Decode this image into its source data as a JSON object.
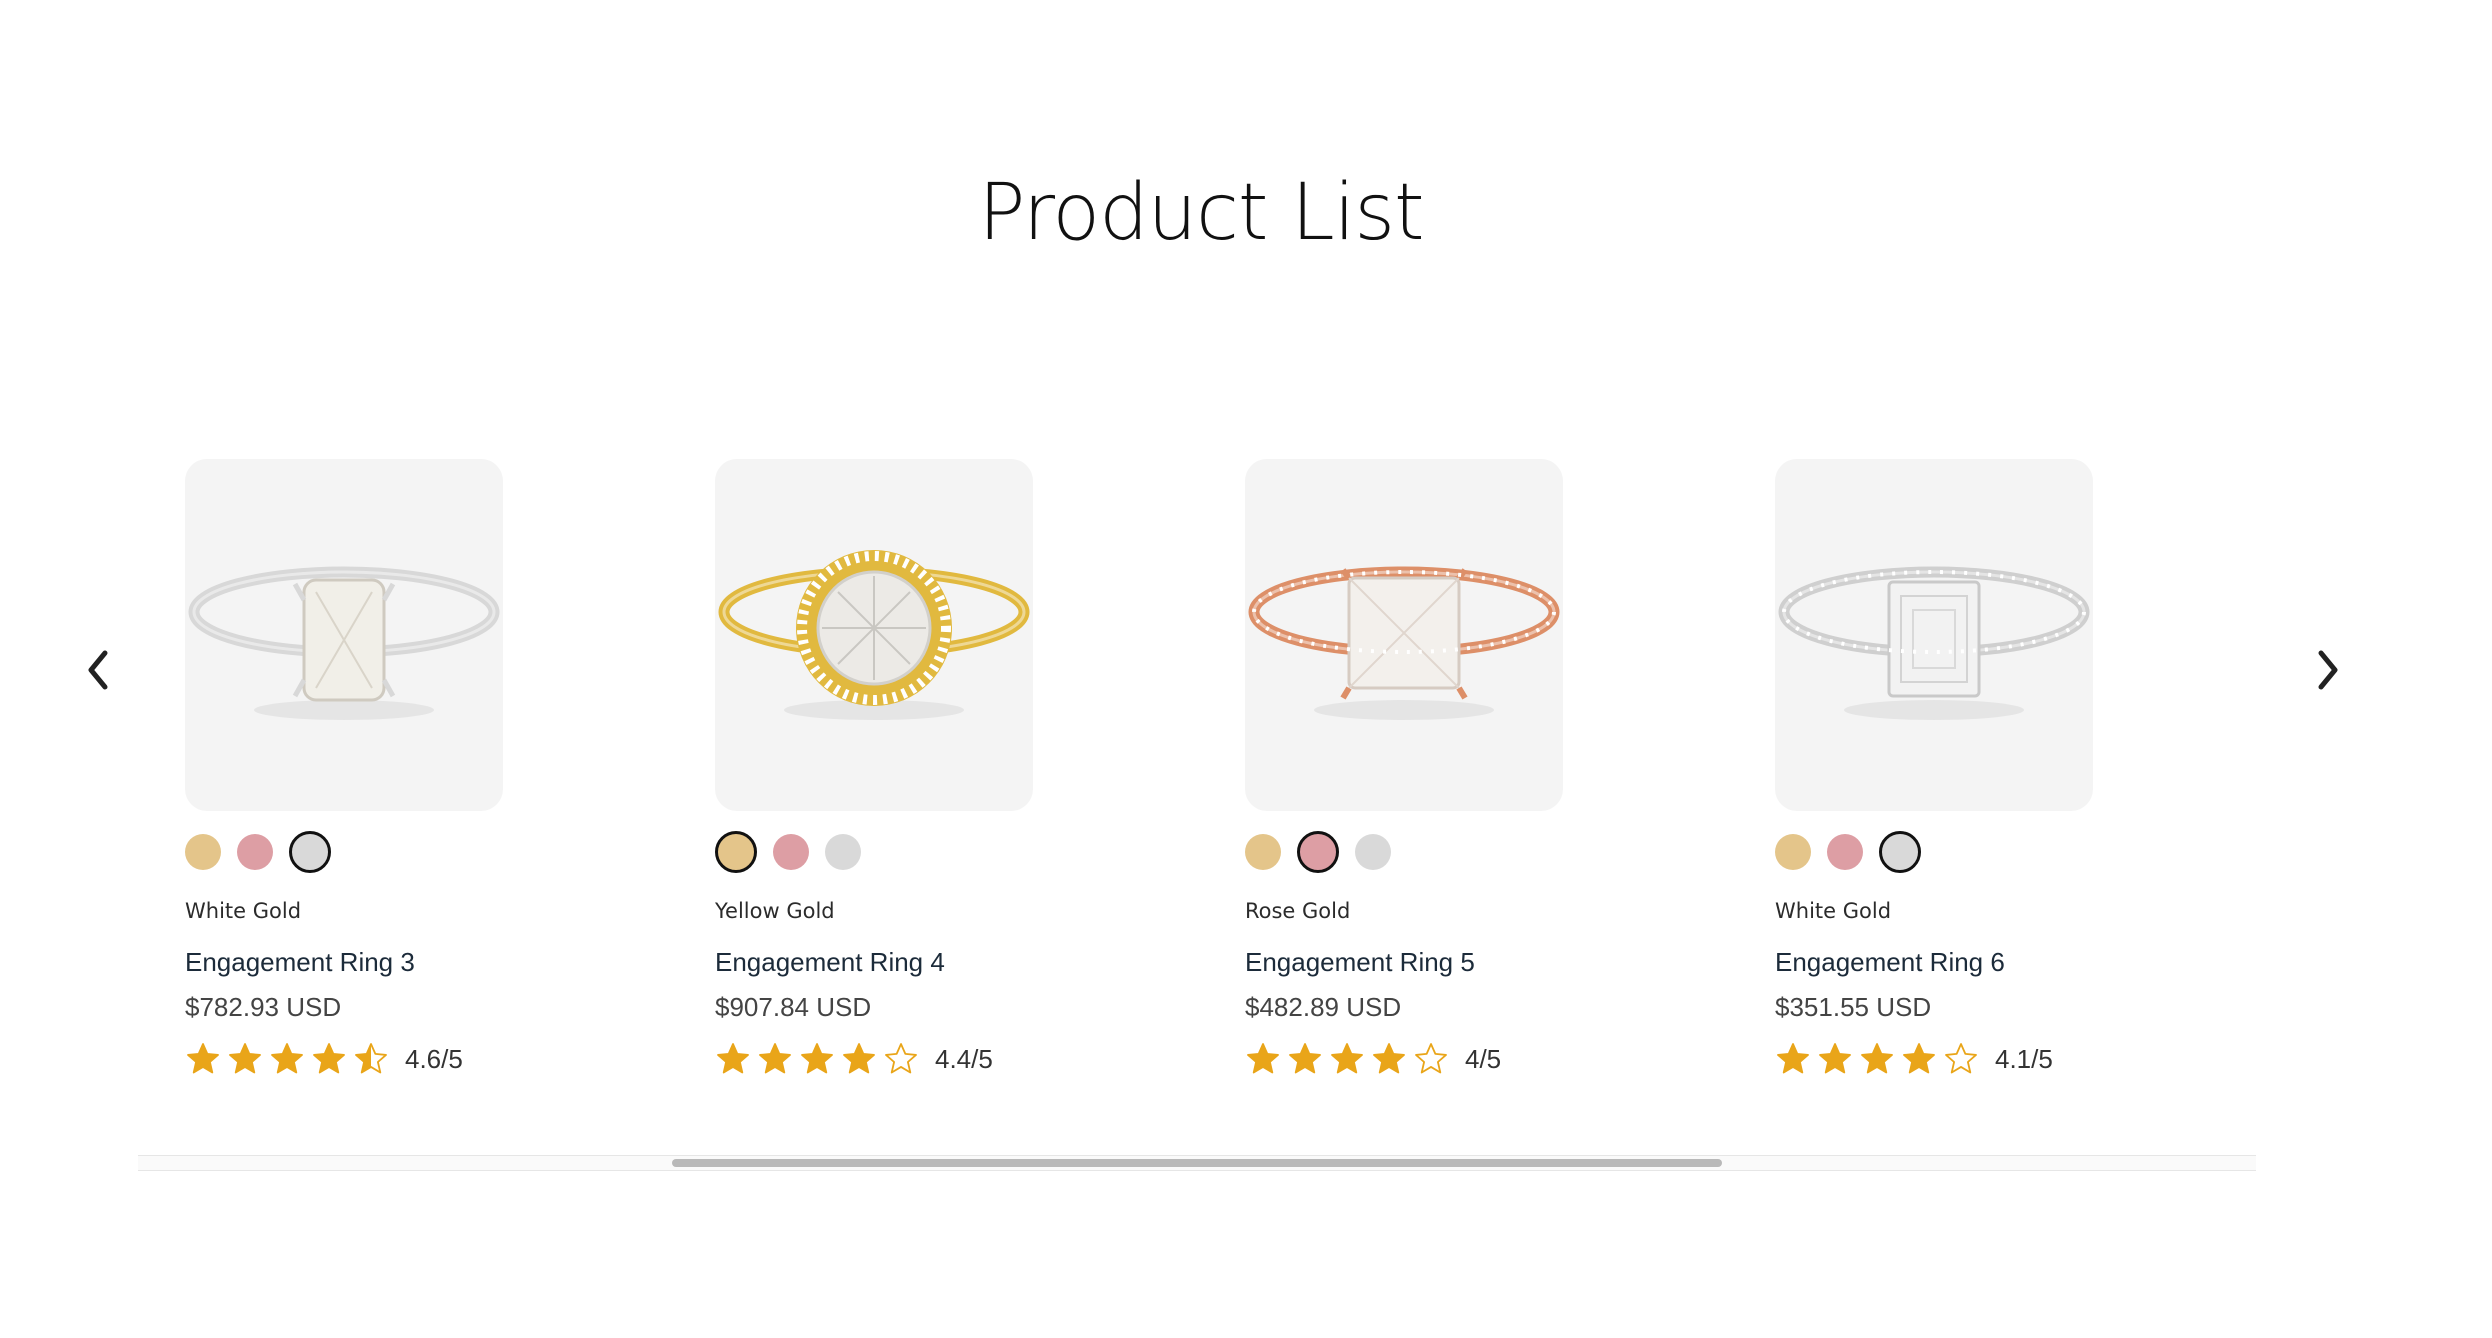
{
  "page": {
    "title": "Product List"
  },
  "carousel": {
    "prev_icon": "chevron-left-icon",
    "next_icon": "chevron-right-icon",
    "scroll_position": 0.5
  },
  "swatch_colors": {
    "yellow": "#e4c58a",
    "rose": "#dd9ea4",
    "white": "#d9d9d9"
  },
  "star_color": "#e9a519",
  "products": [
    {
      "metal": "White Gold",
      "name": "Engagement Ring 3",
      "price": "$782.93 USD",
      "rating": 4.6,
      "rating_label": "4.6/5",
      "selected_swatch": 2,
      "ring_color": "#d8d8d8",
      "stone": "radiant"
    },
    {
      "metal": "Yellow Gold",
      "name": "Engagement Ring 4",
      "price": "$907.84 USD",
      "rating": 4.4,
      "rating_label": "4.4/5",
      "selected_swatch": 0,
      "ring_color": "#e1b93f",
      "stone": "halo-round"
    },
    {
      "metal": "Rose Gold",
      "name": "Engagement Ring 5",
      "price": "$482.89 USD",
      "rating": 4,
      "rating_label": "4/5",
      "selected_swatch": 1,
      "ring_color": "#dd8f68",
      "stone": "princess"
    },
    {
      "metal": "White Gold",
      "name": "Engagement Ring 6",
      "price": "$351.55 USD",
      "rating": 4.1,
      "rating_label": "4.1/5",
      "selected_swatch": 2,
      "ring_color": "#cfcfcf",
      "stone": "emerald"
    }
  ]
}
